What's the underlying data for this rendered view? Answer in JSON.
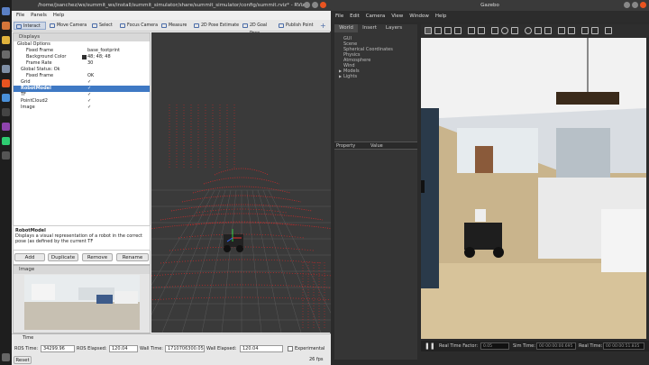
{
  "rviz": {
    "title": "/home/jsanchez/ws/summit_ws/install/summit_simulator/share/summit_simulator/config/summit.rviz* - RViz",
    "menu": [
      "File",
      "Panels",
      "Help"
    ],
    "tools": [
      "Interact",
      "Move Camera",
      "Select",
      "Focus Camera",
      "Measure",
      "2D Pose Estimate",
      "2D Goal Pose",
      "Publish Point"
    ],
    "displays_title": "Displays",
    "tree": [
      {
        "k": "Global Options",
        "v": "",
        "lvl": 0
      },
      {
        "k": "Fixed Frame",
        "v": "base_footprint",
        "lvl": 1
      },
      {
        "k": "Background Color",
        "v": "48; 48; 48",
        "lvl": 1
      },
      {
        "k": "Frame Rate",
        "v": "30",
        "lvl": 1
      },
      {
        "k": "Global Status: Ok",
        "v": "",
        "lvl": 0
      },
      {
        "k": "Fixed Frame",
        "v": "OK",
        "lvl": 1
      },
      {
        "k": "Grid",
        "v": "✓",
        "lvl": 0
      },
      {
        "k": "RobotModel",
        "v": "✓",
        "lvl": 0
      },
      {
        "k": "TF",
        "v": "✓",
        "lvl": 0
      },
      {
        "k": "PointCloud2",
        "v": "✓",
        "lvl": 0
      },
      {
        "k": "Image",
        "v": "✓",
        "lvl": 0
      }
    ],
    "desc_title": "RobotModel",
    "desc_text": "Displays a visual representation of a robot in the correct pose (as defined by the current TF",
    "buttons": [
      "Add",
      "Duplicate",
      "Remove",
      "Rename"
    ],
    "image_panel": "Image",
    "time_panel": "Time",
    "ros_time_label": "ROS Time:",
    "ros_time": "34299.96",
    "ros_elapsed_label": "ROS Elapsed:",
    "ros_elapsed": "120.04",
    "wall_time_label": "Wall Time:",
    "wall_time": "1710706300.05",
    "wall_elapsed_label": "Wall Elapsed:",
    "wall_elapsed": "120.04",
    "experimental": "Experimental",
    "reset": "Reset",
    "fps": "26 fps"
  },
  "gazebo": {
    "title": "Gazebo",
    "menu": [
      "File",
      "Edit",
      "Camera",
      "View",
      "Window",
      "Help"
    ],
    "tabs": [
      "World",
      "Insert",
      "Layers"
    ],
    "world_items": [
      "GUI",
      "Scene",
      "Spherical Coordinates",
      "Physics",
      "Atmosphere",
      "Wind",
      "Models",
      "Lights"
    ],
    "prop_header": "Property",
    "value_header": "Value",
    "rtf_label": "Real Time Factor:",
    "rtf": "0.05",
    "sim_label": "Sim Time:",
    "sim": "00 00:00:00.695",
    "real_label": "Real Time:",
    "real": "00 00:00:51.835",
    "pause_icon": "pause-icon",
    "accent": "#3f79c4"
  }
}
